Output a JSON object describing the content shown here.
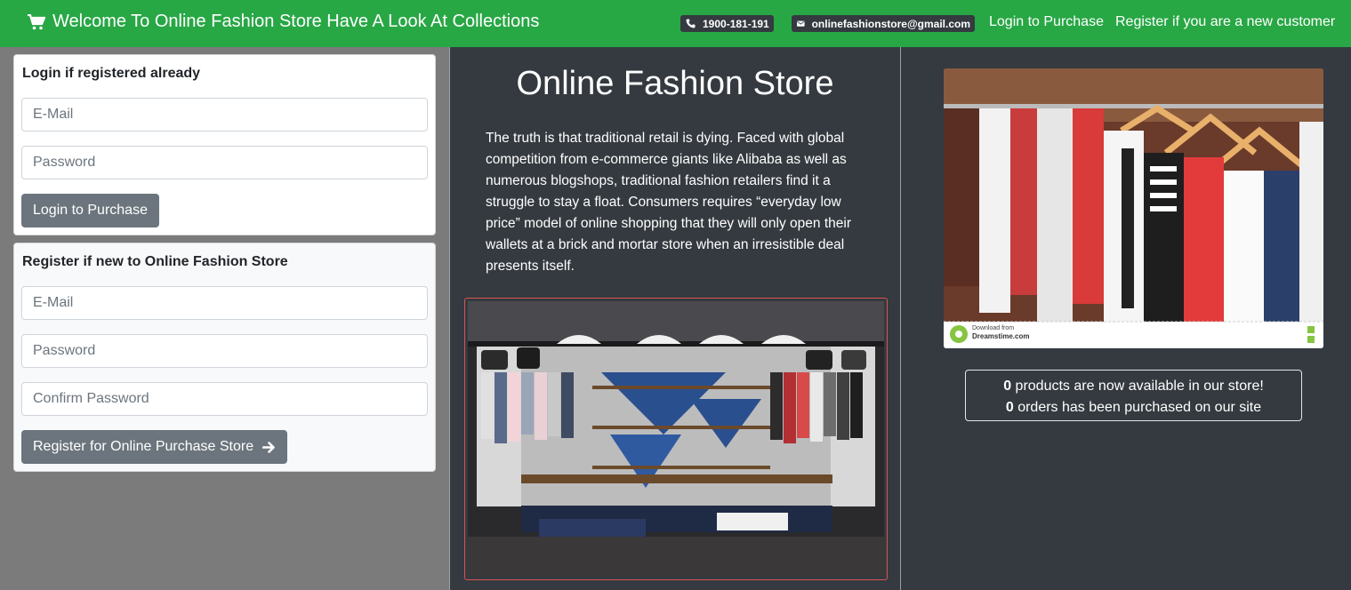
{
  "nav": {
    "brand": "Welcome To Online Fashion Store Have A Look At Collections",
    "phone": "1900-181-191",
    "email": "onlinefashionstore@gmail.com",
    "login_link": "Login to Purchase",
    "register_link": "Register if you are a new customer"
  },
  "login_card": {
    "title": "Login if registered already",
    "email_placeholder": "E-Mail",
    "password_placeholder": "Password",
    "button": "Login to Purchase"
  },
  "register_card": {
    "title": "Register if new to Online Fashion Store",
    "email_placeholder": "E-Mail",
    "password_placeholder": "Password",
    "confirm_placeholder": "Confirm Password",
    "button": "Register for Online Purchase Store"
  },
  "main": {
    "title": "Online Fashion Store",
    "text": "The truth is that traditional retail is dying. Faced with global competition from e-commerce giants like Alibaba as well as numerous blogshops, traditional fashion retailers find it a struggle to stay a float. Consumers requires “everyday low price” model of online shopping that they will only open their wallets at a brick and mortar store when an irresistible deal presents itself."
  },
  "watermark": {
    "line1": "Download from",
    "line2": "Dreamstime.com"
  },
  "stats": {
    "products_count": "0",
    "products_text": " products are now available in our store!",
    "orders_count": "0",
    "orders_text": " orders has been purchased on our site"
  },
  "colors": {
    "navbar": "#28a745",
    "dark_panel": "#343a40",
    "button": "#6c757d"
  }
}
